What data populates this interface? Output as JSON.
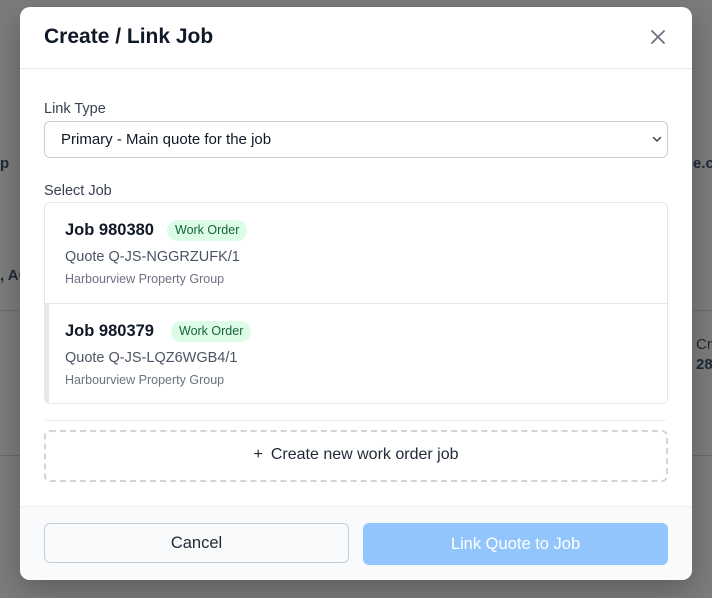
{
  "background": {
    "fragments": [
      {
        "name": "bg-fragment-left-1",
        "text": "p"
      },
      {
        "name": "bg-fragment-left-2",
        "text": ", AC"
      },
      {
        "name": "bg-fragment-right-1",
        "text": "e.co"
      },
      {
        "name": "bg-fragment-right-2",
        "text": "Cr"
      },
      {
        "name": "bg-fragment-right-3",
        "text": "28"
      }
    ]
  },
  "modal": {
    "title": "Create / Link Job",
    "close_icon": "close-icon",
    "link_type": {
      "label": "Link Type",
      "selected": "Primary - Main quote for the job"
    },
    "select_job": {
      "label": "Select Job",
      "jobs": [
        {
          "title": "Job 980380",
          "badge": "Work Order",
          "quote": "Quote Q-JS-NGGRZUFK/1",
          "client": "Harbourview Property Group"
        },
        {
          "title": "Job 980379",
          "badge": "Work Order",
          "quote": "Quote Q-JS-LQZ6WGB4/1",
          "client": "Harbourview Property Group"
        }
      ]
    },
    "create_new": {
      "icon": "plus-icon",
      "label": "Create new work order job"
    },
    "footer": {
      "cancel": "Cancel",
      "primary": "Link Quote to Job"
    }
  },
  "colors": {
    "badge_bg": "#dcfce7",
    "badge_text": "#166534",
    "primary_disabled": "#93c5fd",
    "overlay": "#7c7c7c"
  }
}
